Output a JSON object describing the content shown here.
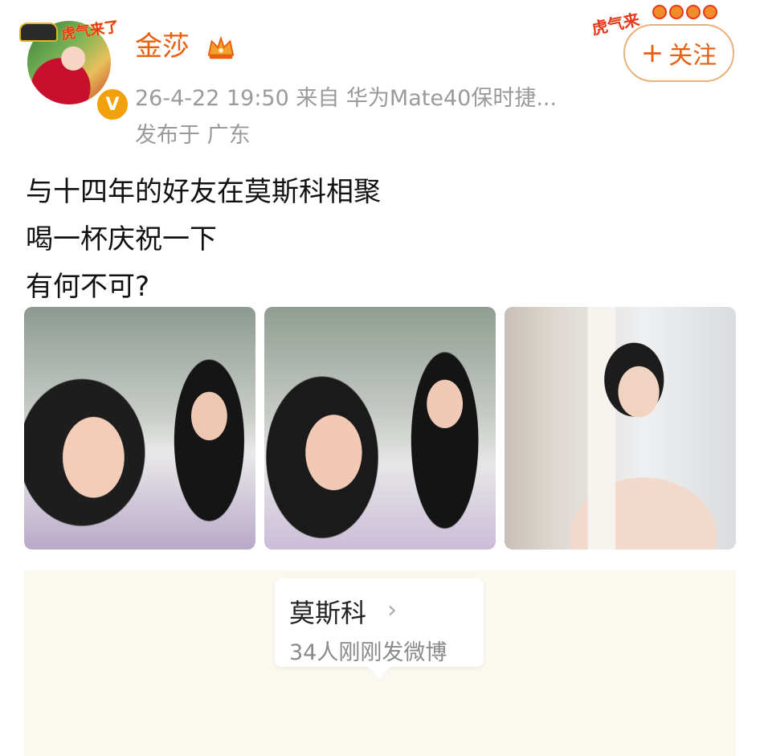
{
  "user": {
    "name": "金莎",
    "avatar_frame_text": "虎气来了",
    "verified_icon": "verified-badge-icon",
    "vip_icon": "crown-icon"
  },
  "meta": {
    "line1": "26-4-22 19:50   来自 华为Mate40保时捷...",
    "line2": "发布于 广东"
  },
  "decoration": {
    "text": "虎气来"
  },
  "follow_button": {
    "icon": "plus-icon",
    "label": "关注"
  },
  "post": {
    "lines": [
      "与十四年的好友在莫斯科相聚",
      "喝一杯庆祝一下",
      "有何不可?"
    ]
  },
  "photos": {
    "count": 3
  },
  "location": {
    "name": "莫斯科",
    "count_text": "34人刚刚发微博"
  },
  "colors": {
    "username": "#e8600f",
    "follow_border": "#e8b27a",
    "meta_text": "#9a9a9a",
    "location_bg": "#fbf8ef",
    "verified_badge": "#f3a10a"
  }
}
